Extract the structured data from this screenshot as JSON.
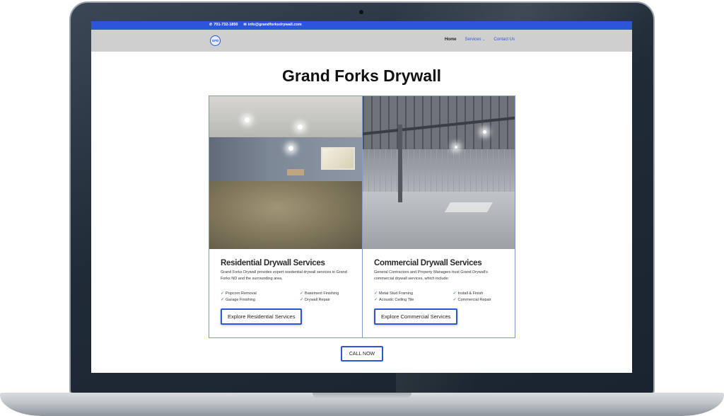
{
  "topbar": {
    "phone": "701-732-1850",
    "email": "info@grandforksdrywall.com",
    "phone_icon": "phone-icon",
    "email_icon": "envelope-icon"
  },
  "nav": {
    "logo_text": "GFD",
    "items": [
      {
        "label": "Home"
      },
      {
        "label": "Services"
      },
      {
        "label": "Contact Us"
      }
    ]
  },
  "hero": {
    "title": "Grand Forks Drywall"
  },
  "cards": [
    {
      "title": "Residential Drywall Services",
      "description": "Grand Forks Drywall provides expert residential drywall services in Grand Forks ND and the surrounding area.",
      "features": [
        "Popcorn Removal",
        "Basement Finishing",
        "Garage Finishing",
        "Drywall Repair"
      ],
      "button": "Explore Residential Services"
    },
    {
      "title": "Commercial Drywall Services",
      "description": "General Contractors and Property Managers trust Grand Drywall's commercial drywall services, which include:",
      "features": [
        "Metal Stud Framing",
        "Install & Finish",
        "Acoustic Ceiling Tile",
        "Commercial Repair"
      ],
      "button": "Explore Commercial Services"
    }
  ],
  "call_button": "CALL NOW",
  "colors": {
    "accent": "#2c56d8",
    "nav_bg": "#cfcfcf",
    "laptop_frame": "#1f2b36"
  }
}
